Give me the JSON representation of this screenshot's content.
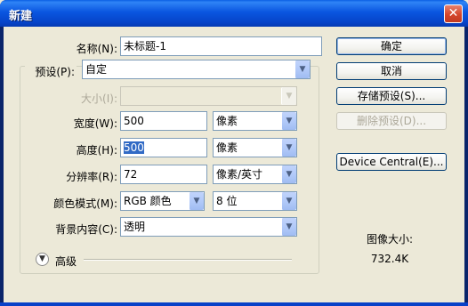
{
  "window": {
    "title": "新建",
    "close_glyph": "✕"
  },
  "form": {
    "name": {
      "label": "名称(N):",
      "value": "未标题-1"
    },
    "preset": {
      "label": "预设(P):",
      "value": "自定"
    },
    "size": {
      "label": "大小(I):",
      "value": ""
    },
    "width": {
      "label": "宽度(W):",
      "value": "500",
      "unit": "像素"
    },
    "height": {
      "label": "高度(H):",
      "value": "500",
      "unit": "像素"
    },
    "resolution": {
      "label": "分辨率(R):",
      "value": "72",
      "unit": "像素/英寸"
    },
    "color_mode": {
      "label": "颜色模式(M):",
      "value": "RGB 颜色",
      "depth": "8 位"
    },
    "background": {
      "label": "背景内容(C):",
      "value": "透明"
    },
    "advanced": {
      "label": "高级",
      "icon": "chevron-down-icon"
    }
  },
  "buttons": {
    "ok": "确定",
    "cancel": "取消",
    "save_preset": "存储预设(S)...",
    "delete_preset": "删除预设(D)...",
    "device_central": "Device Central(E)..."
  },
  "image_size": {
    "label": "图像大小:",
    "value": "732.4K"
  },
  "colors": {
    "title_bar": "#0a56e0",
    "close_button": "#d5452b",
    "dialog_bg": "#ece9d8"
  }
}
